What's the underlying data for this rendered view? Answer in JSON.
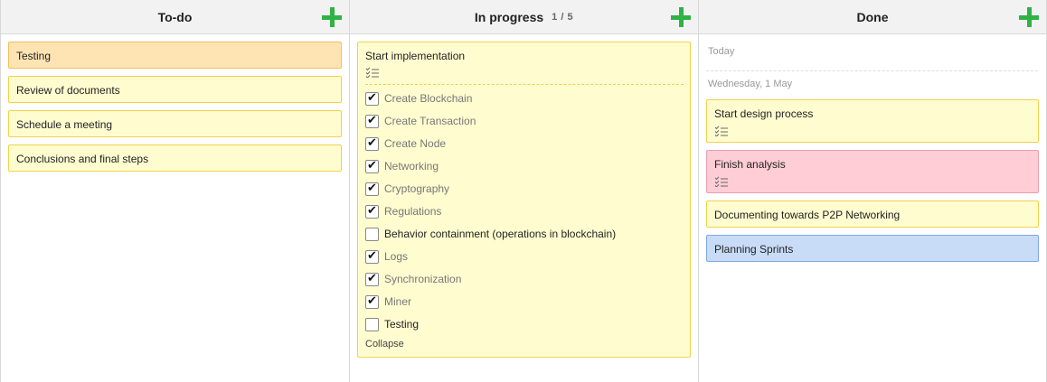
{
  "columns": {
    "todo": {
      "title": "To-do",
      "cards": [
        "Testing",
        "Review of documents",
        "Schedule a meeting",
        "Conclusions and final steps"
      ]
    },
    "in_progress": {
      "title": "In progress",
      "count": "1 / 5",
      "card": {
        "title": "Start implementation",
        "checklist": [
          {
            "label": "Create Blockchain",
            "checked": true
          },
          {
            "label": "Create Transaction",
            "checked": true
          },
          {
            "label": "Create Node",
            "checked": true
          },
          {
            "label": "Networking",
            "checked": true
          },
          {
            "label": "Cryptography",
            "checked": true
          },
          {
            "label": "Regulations",
            "checked": true
          },
          {
            "label": "Behavior containment (operations in blockchain)",
            "checked": false
          },
          {
            "label": "Logs",
            "checked": true
          },
          {
            "label": "Synchronization",
            "checked": true
          },
          {
            "label": "Miner",
            "checked": true
          },
          {
            "label": "Testing",
            "checked": false
          }
        ],
        "collapse_label": "Collapse"
      }
    },
    "done": {
      "title": "Done",
      "group_today": "Today",
      "group_date": "Wednesday, 1 May",
      "cards": [
        "Start design process",
        "Finish analysis",
        "Documenting towards P2P Networking",
        "Planning Sprints"
      ]
    }
  },
  "icons": {
    "add": "plus-icon",
    "checklist": "checklist-icon"
  },
  "colors": {
    "accent_green": "#2fb344",
    "card_yellow": "#fffdd0",
    "card_orange": "#ffe4b3",
    "card_pink": "#ffcdd6",
    "card_blue": "#c8dcf8"
  }
}
